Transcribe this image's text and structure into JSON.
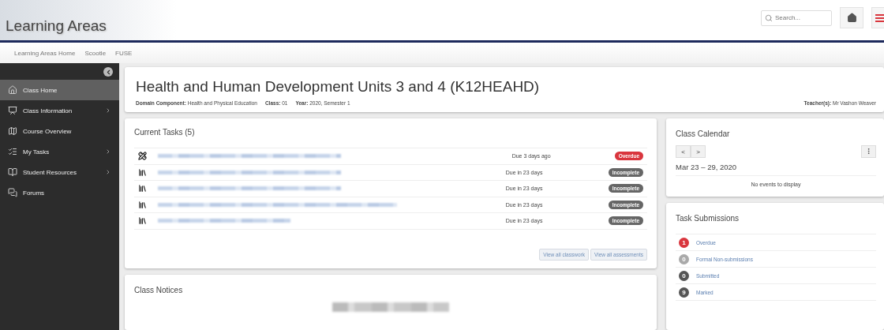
{
  "header": {
    "title": "Learning Areas",
    "search": {
      "placeholder": "Search..."
    }
  },
  "nav_links": [
    "Learning Areas Home",
    "Scootle",
    "FUSE"
  ],
  "sidebar": {
    "items": [
      {
        "label": "Class Home",
        "selected": true,
        "has_submenu": false
      },
      {
        "label": "Class Information",
        "selected": false,
        "has_submenu": true
      },
      {
        "label": "Course Overview",
        "selected": false,
        "has_submenu": false
      },
      {
        "label": "My Tasks",
        "selected": false,
        "has_submenu": true
      },
      {
        "label": "Student Resources",
        "selected": false,
        "has_submenu": true
      },
      {
        "label": "Forums",
        "selected": false,
        "has_submenu": false
      }
    ]
  },
  "course": {
    "title": "Health and Human Development Units 3 and 4 (K12HEAHD)",
    "meta": [
      {
        "label": "Domain Component:",
        "value": "Health and Physical Education"
      },
      {
        "label": "Class:",
        "value": "01"
      },
      {
        "label": "Year:",
        "value": "2020, Semester 1"
      }
    ],
    "teacher": {
      "label": "Teacher(s):",
      "value": "Mr Vashon Weaver"
    }
  },
  "current_tasks": {
    "title": "Current Tasks (5)",
    "tasks": [
      {
        "kind": "assessment",
        "due": "Due 3 days ago",
        "status": "Overdue",
        "overdue": true
      },
      {
        "kind": "classwork",
        "due": "Due in 23 days",
        "status": "Incomplete",
        "overdue": false
      },
      {
        "kind": "classwork",
        "due": "Due in 23 days",
        "status": "Incomplete",
        "overdue": false
      },
      {
        "kind": "classwork",
        "due": "Due in 23 days",
        "status": "Incomplete",
        "overdue": false
      },
      {
        "kind": "classwork",
        "due": "Due in 23 days",
        "status": "Incomplete",
        "overdue": false
      }
    ],
    "buttons": [
      "View all classwork",
      "View all assessments"
    ]
  },
  "class_notices": {
    "title": "Class Notices"
  },
  "calendar": {
    "title": "Class Calendar",
    "prev": "<",
    "next": ">",
    "range": "Mar 23 – 29, 2020",
    "empty": "No events to display"
  },
  "submissions": {
    "title": "Task Submissions",
    "items": [
      {
        "count": "1",
        "label": "Overdue",
        "color": "#d9363e"
      },
      {
        "count": "0",
        "label": "Formal Non-submissions",
        "color": "#a9a9a9"
      },
      {
        "count": "0",
        "label": "Submitted",
        "color": "#555555"
      },
      {
        "count": "9",
        "label": "Marked",
        "color": "#555555"
      }
    ]
  }
}
